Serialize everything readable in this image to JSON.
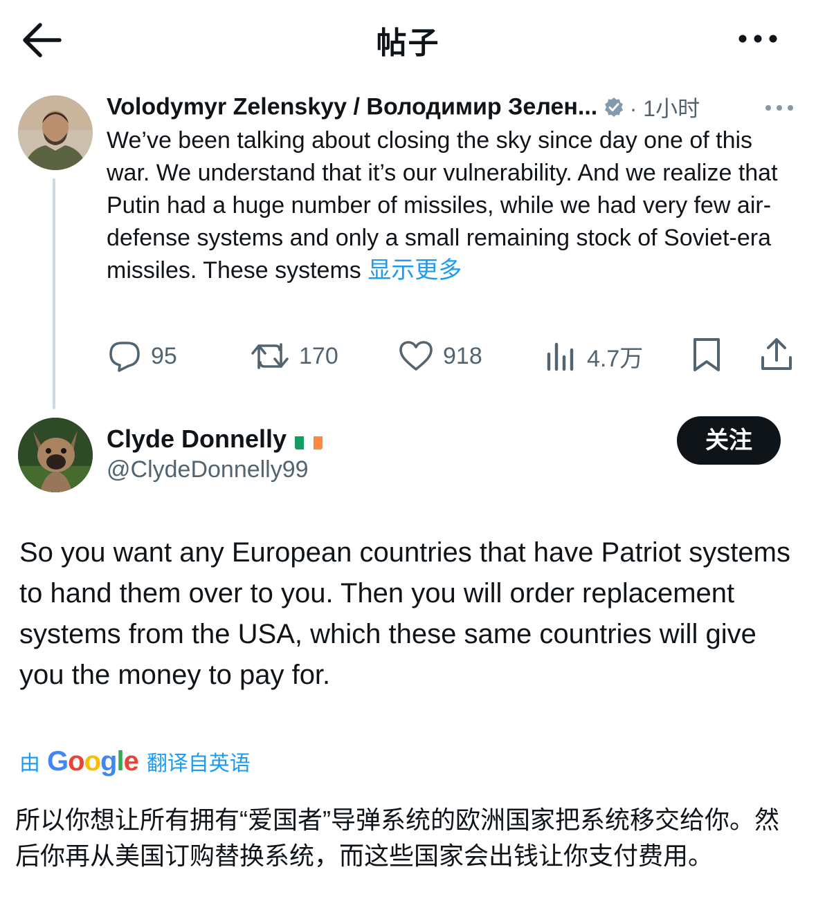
{
  "header": {
    "title": "帖子",
    "back_icon": "arrow-left-icon",
    "more_icon": "more-horizontal-icon"
  },
  "parent_tweet": {
    "author_name": "Volodymyr Zelenskyy / Володимир Зелен...",
    "verified_icon": "verified-badge-icon",
    "time": "· 1小时",
    "text": "We’ve been talking about closing the sky since day one of this war. We understand that it’s our vulnerability. And we realize that Putin had a huge number of missiles, while we had very few air-defense systems and only a small remaining stock of Soviet-era missiles. These systems ",
    "show_more": "显示更多",
    "actions": {
      "replies": "95",
      "retweets": "170",
      "likes": "918",
      "views": "4.7万"
    }
  },
  "reply": {
    "author_name": "Clyde Donnelly",
    "flag": "ireland-flag",
    "handle": "@ClydeDonnelly99",
    "follow_label": "关注",
    "text": "So you want any European countries that have Patriot systems to hand them over to you. Then you will order replacement systems from the USA, which these same countries will give you the money to pay for.",
    "translation": {
      "by_label": "由",
      "provider": "Google",
      "from_label": "翻译自英语",
      "text": "所以你想让所有拥有“爱国者”导弹系统的欧洲国家把系统移交给你。然后你再从美国订购替换系统，而这些国家会出钱让你支付费用。"
    }
  },
  "colors": {
    "accent": "#1d9bf0",
    "text": "#0f1419",
    "muted": "#536471",
    "line": "#cfd9de"
  }
}
